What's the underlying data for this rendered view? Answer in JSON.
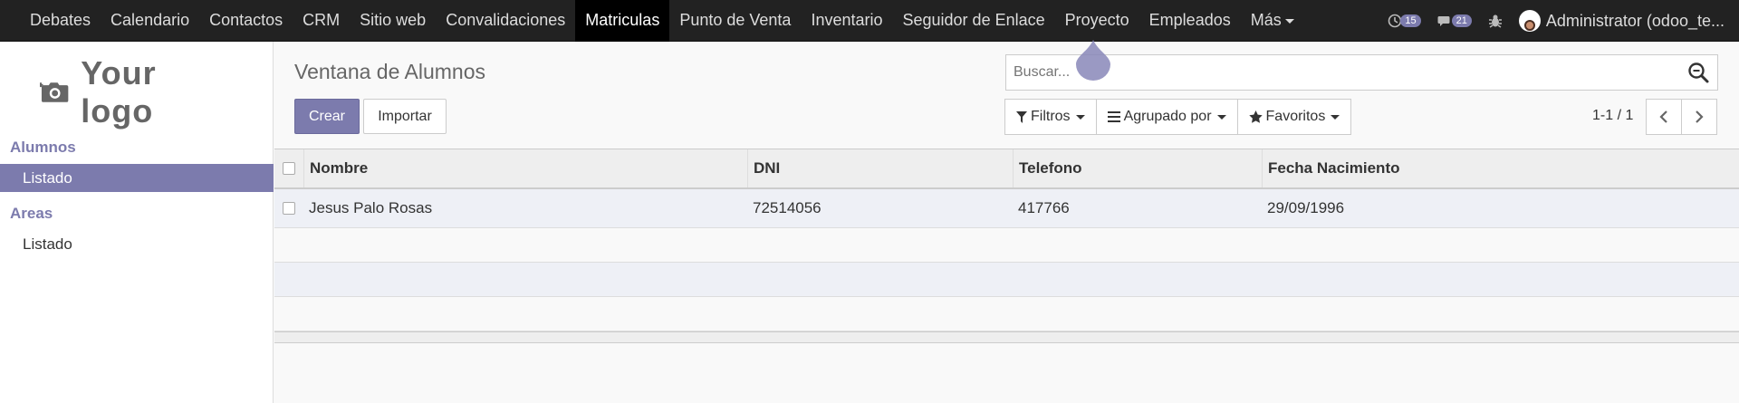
{
  "nav": {
    "items": [
      {
        "label": "Debates"
      },
      {
        "label": "Calendario"
      },
      {
        "label": "Contactos"
      },
      {
        "label": "CRM"
      },
      {
        "label": "Sitio web"
      },
      {
        "label": "Convalidaciones"
      },
      {
        "label": "Matriculas"
      },
      {
        "label": "Punto de Venta"
      },
      {
        "label": "Inventario"
      },
      {
        "label": "Seguidor de Enlace"
      },
      {
        "label": "Proyecto"
      },
      {
        "label": "Empleados"
      }
    ],
    "more_label": "Más",
    "activity_count": "15",
    "messages_count": "21",
    "user_name": "Administrator (odoo_te..."
  },
  "sidebar": {
    "logo_text": "Your logo",
    "sections": [
      {
        "title": "Alumnos",
        "items": [
          {
            "label": "Listado"
          }
        ]
      },
      {
        "title": "Areas",
        "items": [
          {
            "label": "Listado"
          }
        ]
      }
    ]
  },
  "control": {
    "breadcrumb": "Ventana de Alumnos",
    "create_label": "Crear",
    "import_label": "Importar",
    "search_placeholder": "Buscar...",
    "filters_label": "Filtros",
    "groupby_label": "Agrupado por",
    "favorites_label": "Favoritos",
    "pager_text": "1-1 / 1"
  },
  "table": {
    "columns": [
      "Nombre",
      "DNI",
      "Telefono",
      "Fecha Nacimiento"
    ],
    "rows": [
      [
        "Jesus Palo Rosas",
        "72514056",
        "417766",
        "29/09/1996"
      ]
    ]
  },
  "colors": {
    "accent": "#7c7bad",
    "topbar": "#222222",
    "active_menu": "#000000"
  }
}
